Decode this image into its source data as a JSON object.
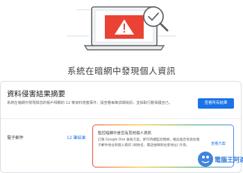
{
  "page": {
    "title": "系統在暗網中發現個人資訊"
  },
  "card": {
    "title": "資料侵害結果摘要",
    "description": "系統在暗網中發現與您的帳戶相關的 12 筆資料侵害事件，請查看每筆詳細資訊，並採取行動保護自己。",
    "view_results_label": "查看所有結果",
    "row": {
      "label": "電子郵件",
      "count": "12 筆結果"
    },
    "promo": {
      "title": "監控暗網中是否有其他個人資訊",
      "body": "訂閱 Google One 會員方案，即可持續監控暗網，確認是否有其他電子郵件地址和個人資訊 (如姓名、電話號碼和住家地址) 外洩。",
      "link": "查看方案"
    }
  },
  "watermark": {
    "text": "電腦王阿達"
  },
  "colors": {
    "accent": "#1a73e8",
    "warning": "#ea4335"
  },
  "icons": [
    "warning-icon",
    "magnifier-check-icon",
    "laptop-icon"
  ]
}
